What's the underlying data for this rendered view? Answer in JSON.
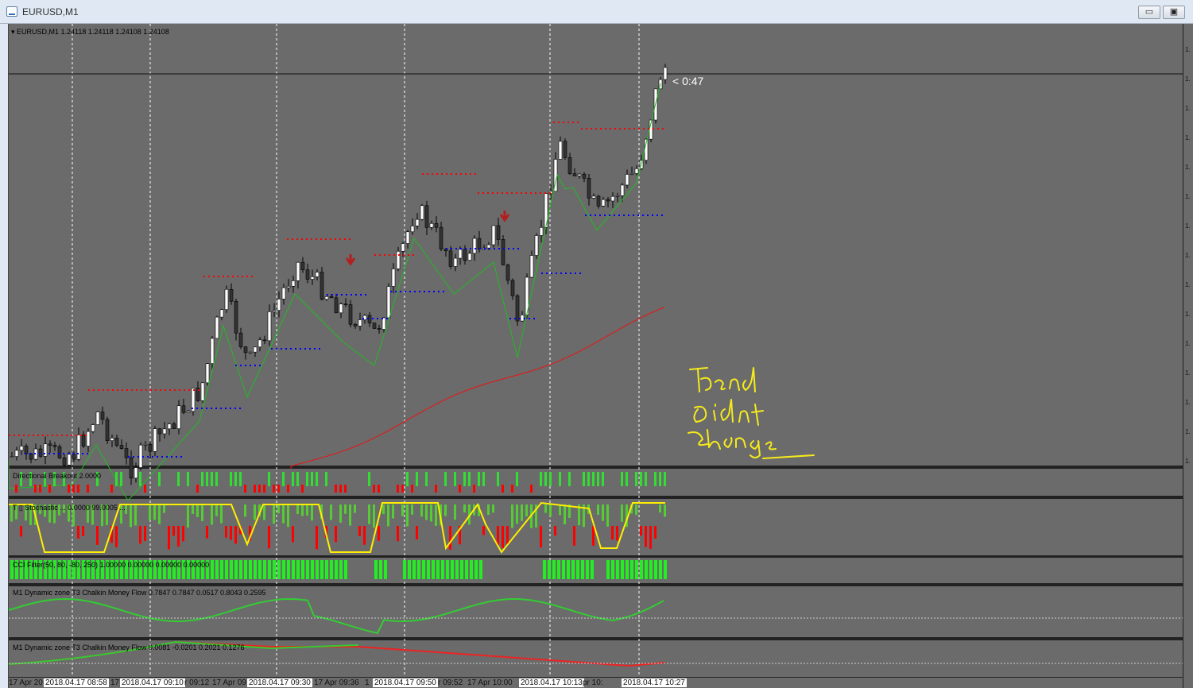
{
  "window": {
    "title": "EURUSD,M1",
    "minimize_label": "▭",
    "maximize_label": "▣"
  },
  "chart": {
    "symbol_label": "▾ EURUSD,M1  1.24118 1.24118 1.24108 1.24108",
    "countdown": "< 0:47",
    "scale_ticks": [
      "1.",
      "1.",
      "1.",
      "1.",
      "1.",
      "1.",
      "1.",
      "1.",
      "1.",
      "1.",
      "1.",
      "1.",
      "1.",
      "1.",
      "1."
    ],
    "time_labels": [
      {
        "text": "17 Apr 20",
        "boxed": false
      },
      {
        "text": "2018.04.17 08:58",
        "boxed": true
      },
      {
        "text": "17",
        "boxed": false
      },
      {
        "text": "2018.04.17 09:10",
        "boxed": true
      },
      {
        "text": "r 09:12",
        "boxed": false
      },
      {
        "text": "17 Apr 09",
        "boxed": false
      },
      {
        "text": "2018.04.17 09:30",
        "boxed": true
      },
      {
        "text": "17 Apr 09:36",
        "boxed": false
      },
      {
        "text": "1",
        "boxed": false
      },
      {
        "text": "2018.04.17 09:50",
        "boxed": true
      },
      {
        "text": "r 09:52",
        "boxed": false
      },
      {
        "text": "17 Apr 10:00",
        "boxed": false
      },
      {
        "text": "2018.04.17 10:13",
        "boxed": true
      },
      {
        "text": "pr 10:",
        "boxed": false
      },
      {
        "text": "2018.04.17 10:27",
        "boxed": true
      }
    ]
  },
  "panels": {
    "directional": "Directional Breakout 2.0000",
    "stoch": "T ▯ Stochastic ... 0.0000 99.0005 ...",
    "cci": "CCI Filter(50, 80, -80, 250) 1.00000 0.00000 0.00000 0.00000",
    "chalkin1": "M1 Dynamic zone T3 Chalkin Money Flow  0.7847 0.7847 0.0517 0.8043 0.2595",
    "chalkin2": "M1 Dynamic zone T3 Chalkin Money Flow  0.0081 -0.0201 0.2021 0.1276"
  },
  "annotation": {
    "lines": [
      "Trend",
      "didnt",
      "change"
    ],
    "color": "#f5ea1c"
  },
  "colors": {
    "bg": "#6b6b6b",
    "bull": "#ffffff",
    "bear": "#333333",
    "red": "#ff0000",
    "blue": "#0000ff",
    "green": "#00cc00",
    "yellow": "#ffee00"
  }
}
